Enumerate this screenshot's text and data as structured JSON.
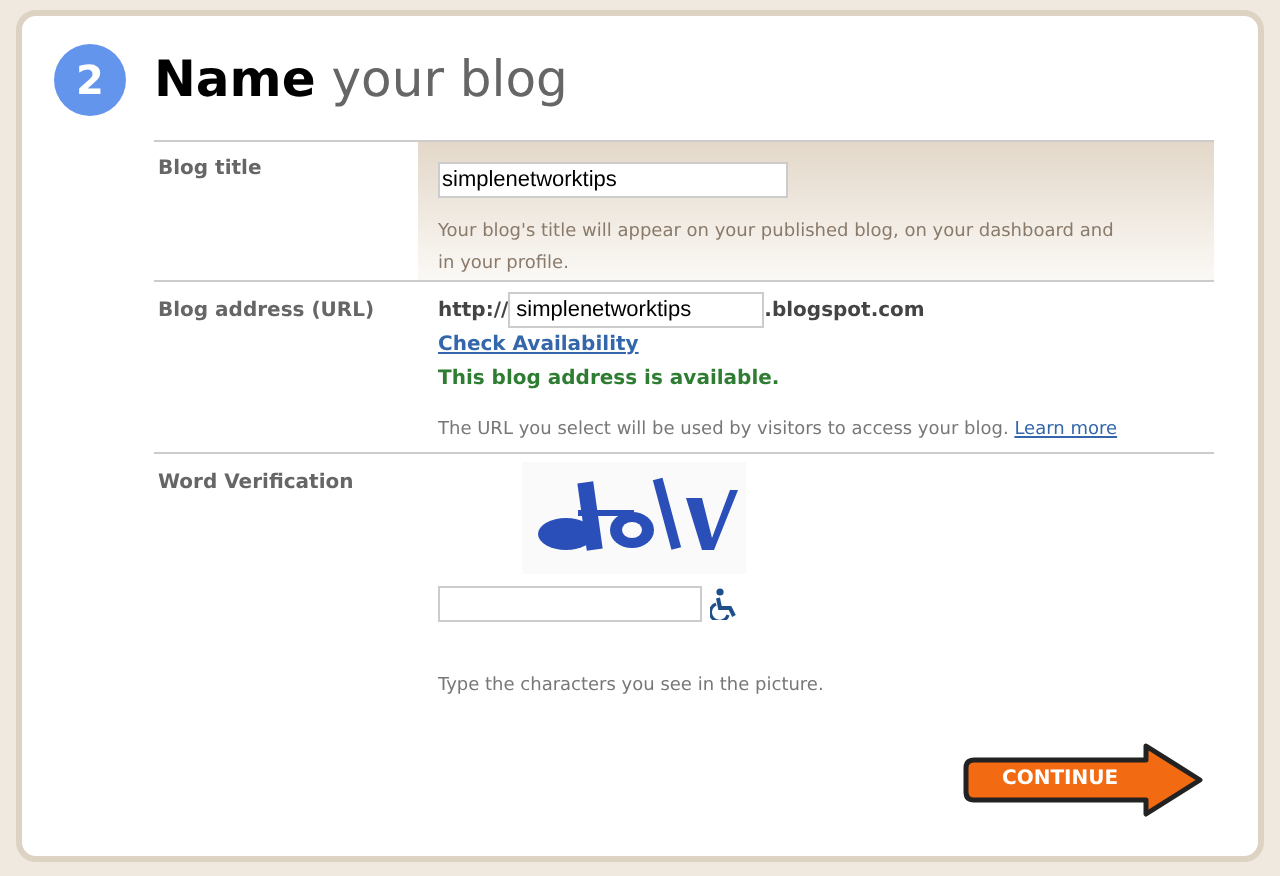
{
  "step": {
    "number": "2",
    "title_bold": "Name",
    "title_rest": "your blog"
  },
  "blog_title": {
    "label": "Blog title",
    "value": "simplenetworktips",
    "help": "Your blog's title will appear on your published blog, on your dashboard and in your profile."
  },
  "blog_address": {
    "label": "Blog address (URL)",
    "prefix": "http://",
    "value": "simplenetworktips",
    "suffix": ".blogspot.com",
    "check_link": "Check Availability",
    "status": "This blog address is available.",
    "help": "The URL you select will be used by visitors to access your blog.",
    "help_link": "Learn more"
  },
  "word_verification": {
    "label": "Word Verification",
    "help": "Type the characters you see in the picture."
  },
  "continue_button": "CONTINUE"
}
